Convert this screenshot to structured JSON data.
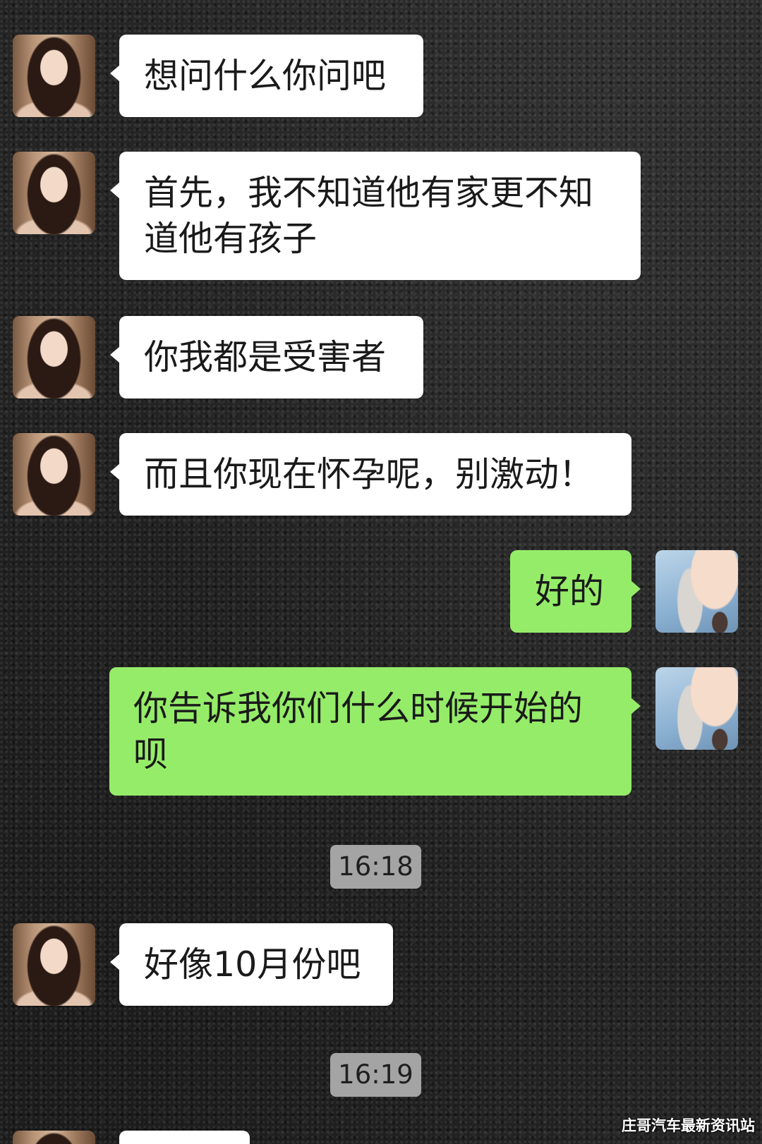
{
  "chat": {
    "messages": [
      {
        "outgoing": false,
        "text": "想问什么你问吧"
      },
      {
        "outgoing": false,
        "text": "首先，我不知道他有家更不知道他有孩子"
      },
      {
        "outgoing": false,
        "text": "你我都是受害者"
      },
      {
        "outgoing": false,
        "text": "而且你现在怀孕呢，别激动！"
      },
      {
        "outgoing": true,
        "text": "好的"
      },
      {
        "outgoing": true,
        "text": "你告诉我你们什么时候开始的呗"
      },
      {
        "outgoing": false,
        "text": "好像10月份吧"
      }
    ],
    "timestamps": [
      "16:18",
      "16:19"
    ]
  },
  "watermark": "庄哥汽车最新资讯站",
  "colors": {
    "bubble_incoming": "#ffffff",
    "bubble_outgoing": "#95ec69",
    "timestamp_bg": "#a4a4a4",
    "background": "#242424"
  }
}
